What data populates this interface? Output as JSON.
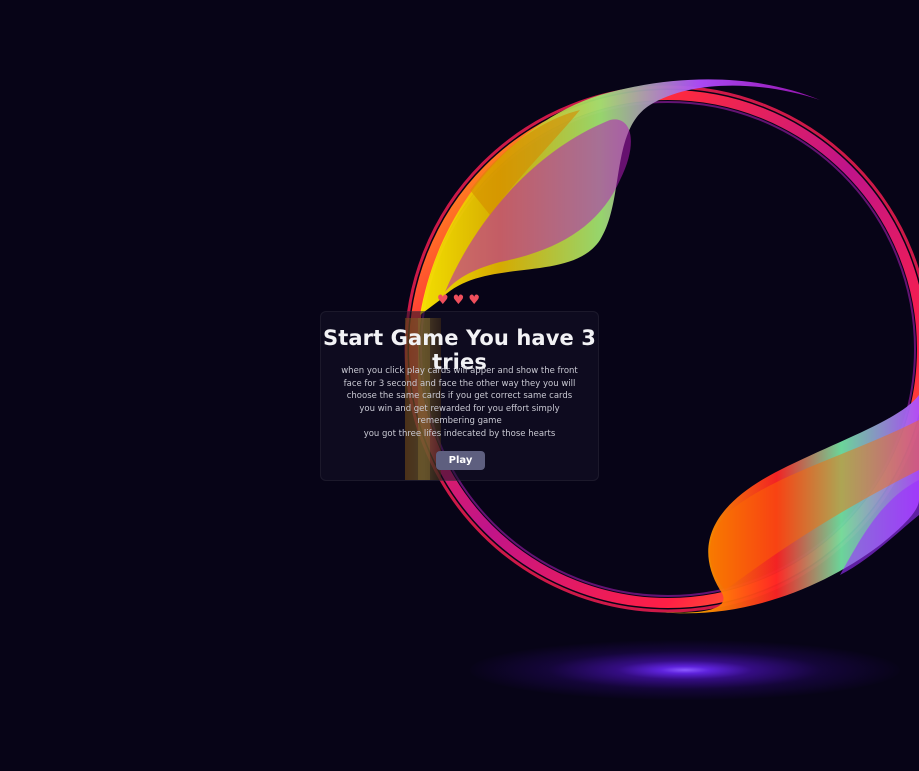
{
  "game": {
    "lives": 3,
    "hearts": [
      "♥",
      "♥",
      "♥"
    ],
    "title": "Start Game You have 3 tries",
    "description": "when you click play cards will apper and show the front face for 3 second and face the other way they you will choose the same cards if you get correct same cards you win and get rewarded for you effort simply remembering game",
    "lives_note": "you got three lifes indecated by those hearts",
    "play_label": "Play"
  },
  "colors": {
    "background": "#070417",
    "heart": "#ef4f5c",
    "button": "#5e5f7f",
    "glow": "#7a3cff"
  },
  "icons": {
    "heart": "heart-icon"
  }
}
